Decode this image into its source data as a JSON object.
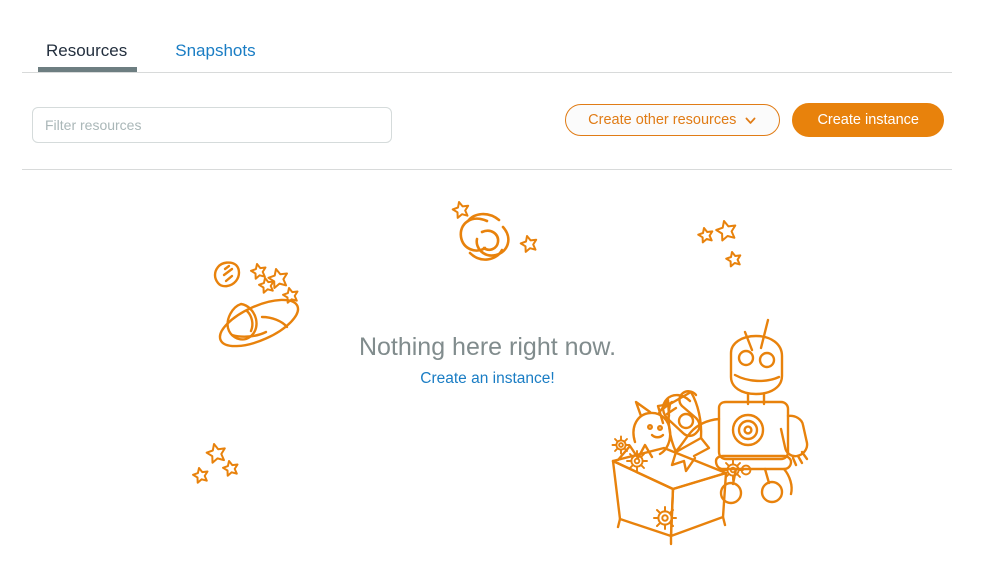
{
  "tabs": [
    {
      "label": "Resources",
      "active": true
    },
    {
      "label": "Snapshots",
      "active": false
    }
  ],
  "toolbar": {
    "filter_placeholder": "Filter resources",
    "filter_value": "",
    "create_other_label": "Create other resources",
    "create_instance_label": "Create instance",
    "chevron_icon": "chevron-down-icon"
  },
  "empty_state": {
    "title": "Nothing here right now.",
    "link_label": "Create an instance!",
    "illustration": {
      "name": "space-robot-illustration",
      "elements": [
        "spiral-galaxy-icon",
        "ringed-planet-icon",
        "meteor-shield-icon",
        "star-cluster-left-icon",
        "star-cluster-bottom-left-icon",
        "star-cluster-top-right-icon",
        "robot-with-wrench-icon",
        "open-box-with-rocket-icon",
        "gear-icon"
      ]
    }
  },
  "colors": {
    "accent_orange": "#e8820c",
    "accent_orange_line": "#e07c16",
    "link_blue": "#1a7dc4",
    "tab_active_text": "#232f3e",
    "tab_underline": "#6d7e81",
    "muted_text": "#818c8d",
    "placeholder": "#aab7b8",
    "divider": "#d8dada",
    "input_border": "#d5dbdb",
    "background": "#ffffff"
  }
}
